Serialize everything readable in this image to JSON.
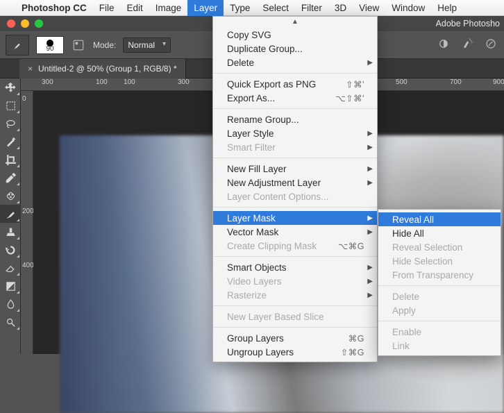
{
  "menubar": {
    "appname": "Photoshop CC",
    "items": [
      "File",
      "Edit",
      "Image",
      "Layer",
      "Type",
      "Select",
      "Filter",
      "3D",
      "View",
      "Window",
      "Help"
    ],
    "active_index": 3
  },
  "window_title": "Adobe Photosho",
  "optionsbar": {
    "brush_size": "90",
    "mode_label": "Mode:",
    "mode_value": "Normal"
  },
  "doctab": {
    "title": "Untitled-2 @ 50% (Group 1, RGB/8) *"
  },
  "ruler_h": [
    "300",
    "100",
    "100",
    "300",
    "500",
    "700",
    "900"
  ],
  "ruler_v": [
    "0",
    "200",
    "400"
  ],
  "layer_menu": {
    "sections": [
      {
        "items": [
          {
            "label": "Copy SVG"
          },
          {
            "label": "Duplicate Group..."
          },
          {
            "label": "Delete",
            "submenu": true
          }
        ]
      },
      {
        "items": [
          {
            "label": "Quick Export as PNG",
            "shortcut": "⇧⌘'"
          },
          {
            "label": "Export As...",
            "shortcut": "⌥⇧⌘'"
          }
        ]
      },
      {
        "items": [
          {
            "label": "Rename Group..."
          },
          {
            "label": "Layer Style",
            "submenu": true
          },
          {
            "label": "Smart Filter",
            "submenu": true,
            "disabled": true
          }
        ]
      },
      {
        "items": [
          {
            "label": "New Fill Layer",
            "submenu": true
          },
          {
            "label": "New Adjustment Layer",
            "submenu": true
          },
          {
            "label": "Layer Content Options...",
            "disabled": true
          }
        ]
      },
      {
        "items": [
          {
            "label": "Layer Mask",
            "submenu": true,
            "hover": true
          },
          {
            "label": "Vector Mask",
            "submenu": true
          },
          {
            "label": "Create Clipping Mask",
            "shortcut": "⌥⌘G",
            "disabled": true
          }
        ]
      },
      {
        "items": [
          {
            "label": "Smart Objects",
            "submenu": true
          },
          {
            "label": "Video Layers",
            "submenu": true,
            "disabled": true
          },
          {
            "label": "Rasterize",
            "submenu": true,
            "disabled": true
          }
        ]
      },
      {
        "items": [
          {
            "label": "New Layer Based Slice",
            "disabled": true
          }
        ]
      },
      {
        "items": [
          {
            "label": "Group Layers",
            "shortcut": "⌘G"
          },
          {
            "label": "Ungroup Layers",
            "shortcut": "⇧⌘G"
          }
        ]
      }
    ]
  },
  "mask_menu": {
    "sections": [
      {
        "items": [
          {
            "label": "Reveal All",
            "hover": true
          },
          {
            "label": "Hide All"
          },
          {
            "label": "Reveal Selection",
            "disabled": true
          },
          {
            "label": "Hide Selection",
            "disabled": true
          },
          {
            "label": "From Transparency",
            "disabled": true
          }
        ]
      },
      {
        "items": [
          {
            "label": "Delete",
            "disabled": true
          },
          {
            "label": "Apply",
            "disabled": true
          }
        ]
      },
      {
        "items": [
          {
            "label": "Enable",
            "disabled": true
          },
          {
            "label": "Link",
            "disabled": true
          }
        ]
      }
    ]
  }
}
